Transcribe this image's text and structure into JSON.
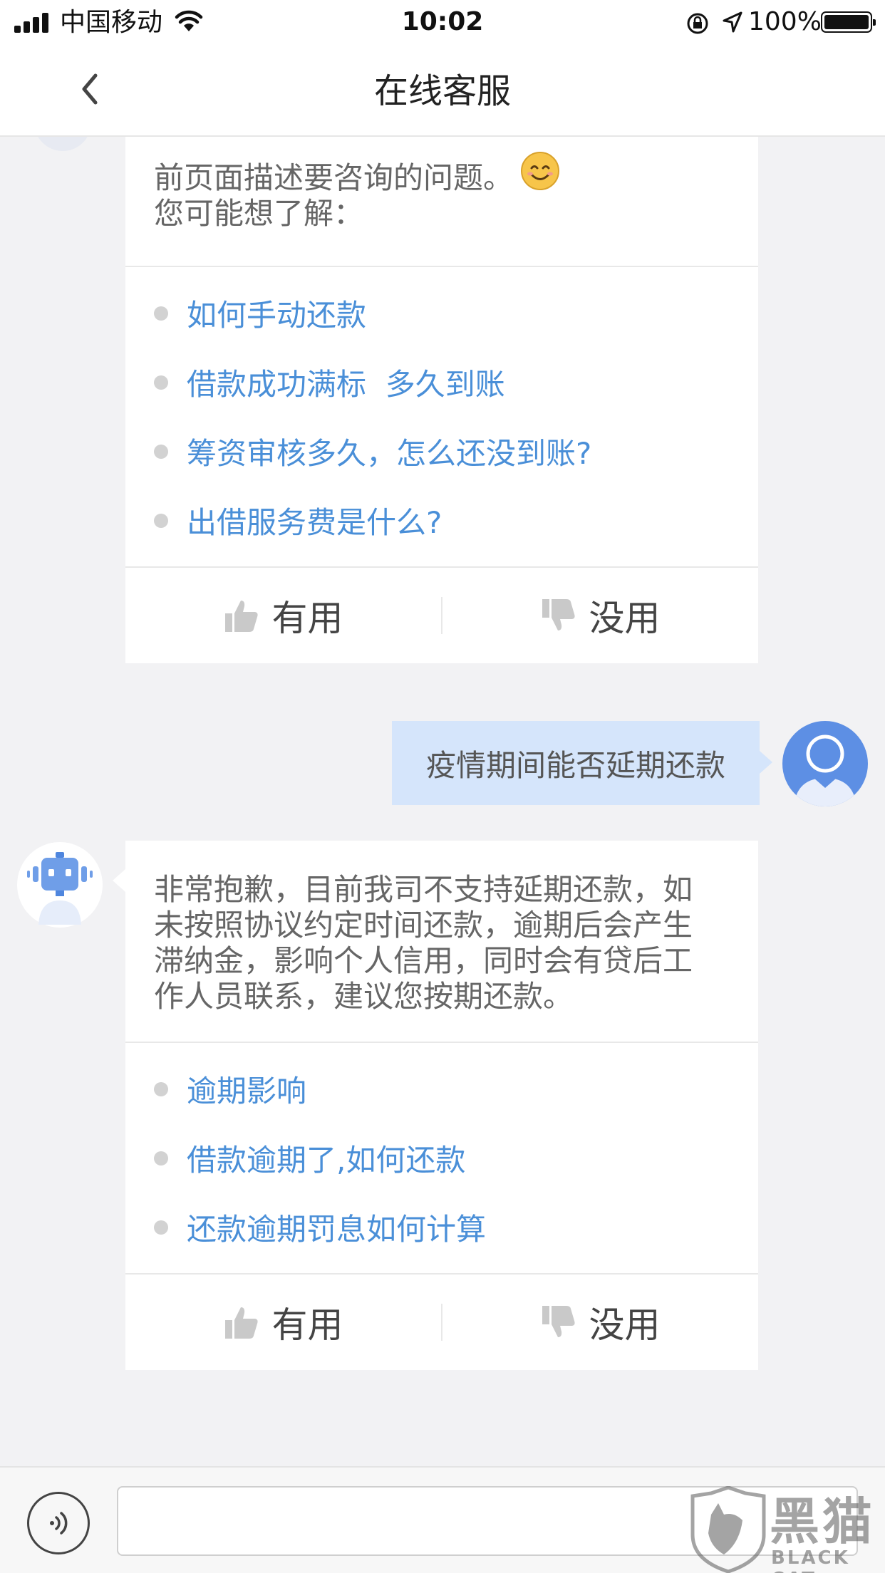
{
  "status_bar": {
    "carrier": "中国移动",
    "time": "10:02",
    "battery": "100%"
  },
  "nav": {
    "title": "在线客服"
  },
  "messages": {
    "bot_1": {
      "text_line1": "前页面描述要咨询的问题。",
      "text_line2": "您可能想了解：",
      "suggestions": [
        "如何手动还款",
        "借款成功满标  多久到账",
        "筹资审核多久，怎么还没到账?",
        "出借服务费是什么?"
      ],
      "useful_label": "有用",
      "useless_label": "没用"
    },
    "user_1": {
      "text": "疫情期间能否延期还款"
    },
    "bot_2": {
      "text_lines": [
        "非常抱歉，目前我司不支持延期还款，如",
        "未按照协议约定时间还款，逾期后会产生",
        "滞纳金，影响个人信用，同时会有贷后工",
        "作人员联系，建议您按期还款。"
      ],
      "suggestions": [
        "逾期影响",
        "借款逾期了,如何还款",
        "还款逾期罚息如何计算"
      ],
      "useful_label": "有用",
      "useless_label": "没用"
    }
  },
  "input": {
    "value": "",
    "voice_icon": "voice-icon"
  },
  "watermark": {
    "title": "黑猫",
    "subtitle": "BLACK CAT"
  },
  "colors": {
    "link": "#4a8fd8",
    "user_bubble": "#d5e5fb",
    "user_avatar": "#5d8fe4",
    "bot_avatar": "#6f9ee8"
  }
}
